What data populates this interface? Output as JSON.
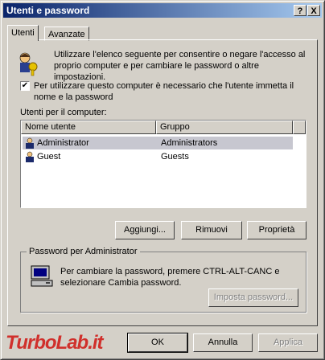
{
  "window": {
    "title": "Utenti e password",
    "help_btn": "?",
    "close_btn": "X"
  },
  "tabs": [
    {
      "label": "Utenti"
    },
    {
      "label": "Avanzate"
    }
  ],
  "info": "Utilizzare l'elenco seguente per consentire o negare l'accesso al proprio computer e per cambiare le password o altre impostazioni.",
  "checkbox": {
    "checked": true,
    "label": "Per utilizzare questo computer è necessario che l'utente immetta il nome e la password"
  },
  "users_label": "Utenti per il computer:",
  "table": {
    "headers": [
      "Nome utente",
      "Gruppo"
    ],
    "rows": [
      {
        "name": "Administrator",
        "group": "Administrators",
        "selected": true
      },
      {
        "name": "Guest",
        "group": "Guests",
        "selected": false
      }
    ]
  },
  "buttons": {
    "add": "Aggiungi...",
    "remove": "Rimuovi",
    "properties": "Proprietà"
  },
  "password_group": {
    "title": "Password per Administrator",
    "text": "Per cambiare la password, premere CTRL-ALT-CANC e selezionare Cambia password.",
    "set_button": "Imposta password..."
  },
  "footer": {
    "ok": "OK",
    "cancel": "Annulla",
    "apply": "Applica"
  },
  "watermark": "TurboLab.it",
  "colors": {
    "titlebar_start": "#0a246a",
    "titlebar_end": "#a6caf0",
    "selection": "#c7c7d0",
    "watermark": "#d0302c"
  }
}
